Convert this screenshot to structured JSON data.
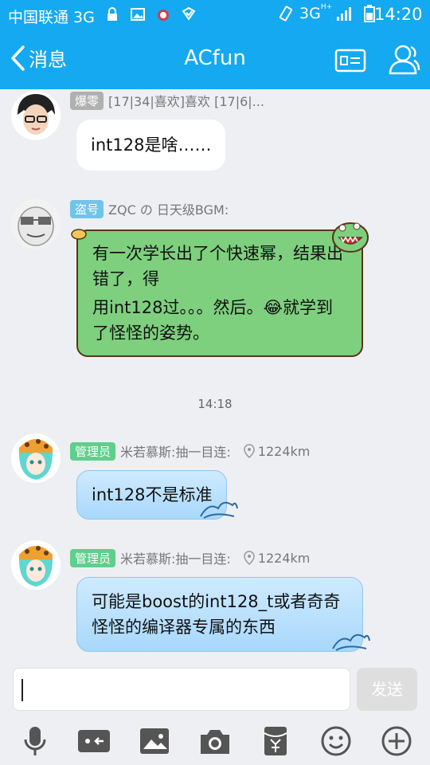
{
  "status_bar": {
    "carrier": "中国联通 3G",
    "network": "3G",
    "network_sup": "H+",
    "time": "14:20",
    "icons": [
      "lock-icon",
      "image-icon",
      "alarm-icon",
      "notification-icon",
      "vibrate-icon",
      "signal-icon",
      "battery-icon"
    ]
  },
  "header": {
    "back_label": "消息",
    "title": "ACfun",
    "icons": [
      "profile-card-icon",
      "group-members-icon"
    ]
  },
  "messages": [
    {
      "badge": "爆零",
      "badge_color": "#b0b0b0",
      "sender": "[17|34|喜欢]喜欢  [17|6|...",
      "text": "int128是啥……",
      "bubble": "white"
    },
    {
      "badge": "盗号",
      "badge_color": "#6fc4ea",
      "sender": "ZQC の 日天级BGM:",
      "text_line1": "有一次学长出了个快速幂，结果出错了，得",
      "text_line2a": "用int128过。。。然后。",
      "emoji": "😂",
      "text_line2b": "就学到了怪怪的姿势。",
      "bubble": "green"
    },
    {
      "badge": "管理员",
      "badge_color": "#5fcf8c",
      "sender": "米若慕斯:抽一目连:",
      "distance": "1224km",
      "text": "int128不是标准",
      "bubble": "blue"
    },
    {
      "badge": "管理员",
      "badge_color": "#5fcf8c",
      "sender": "米若慕斯:抽一目连:",
      "distance": "1224km",
      "text": "可能是boost的int128_t或者奇奇怪怪的编译器专属的东西",
      "bubble": "blue"
    }
  ],
  "timestamp": "14:18",
  "composer": {
    "placeholder": "",
    "send_label": "发送"
  },
  "toolbar_icons": [
    "microphone-icon",
    "video-call-icon",
    "picture-icon",
    "camera-icon",
    "red-packet-icon",
    "emoji-icon",
    "plus-icon"
  ],
  "colors": {
    "accent": "#14a9f0",
    "background": "#eeeff3"
  }
}
